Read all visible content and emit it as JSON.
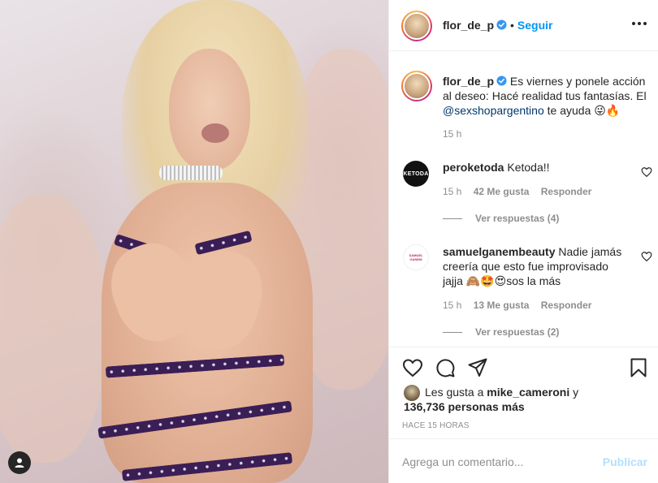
{
  "post": {
    "username": "flor_de_p",
    "follow_label": "Seguir",
    "separator": "•"
  },
  "caption": {
    "username": "flor_de_p",
    "text_before": "Es viernes y ponele acción al deseo: Hacé realidad tus fantasías. El ",
    "mention": "@sexshopargentino",
    "text_after": " te ayuda 😜🔥",
    "time": "15 h"
  },
  "comments": [
    {
      "avatar_text": "KETODA",
      "username": "peroketoda",
      "text": "Ketoda!!",
      "time": "15 h",
      "likes": "42 Me gusta",
      "reply_label": "Responder",
      "view_replies": "Ver respuestas (4)"
    },
    {
      "avatar_text": "SAMUEL GANEM",
      "username": "samuelganembeauty",
      "text": "Nadie jamás creería que esto fue improvisado jajja 🙈🤩😍sos la más",
      "time": "15 h",
      "likes": "13 Me gusta",
      "reply_label": "Responder",
      "view_replies": "Ver respuestas (2)"
    }
  ],
  "likes": {
    "prefix": "Les gusta a ",
    "user": "mike_cameroni",
    "conjunction": " y",
    "count": "136,736 personas más"
  },
  "timestamp": "HACE 15 HORAS",
  "add_comment": {
    "placeholder": "Agrega un comentario...",
    "publish_label": "Publicar"
  },
  "colors": {
    "link_blue": "#0095f6",
    "publish_disabled": "#b2dffc",
    "secondary_text": "#8e8e8e",
    "strap_purple": "#3b1e55"
  }
}
